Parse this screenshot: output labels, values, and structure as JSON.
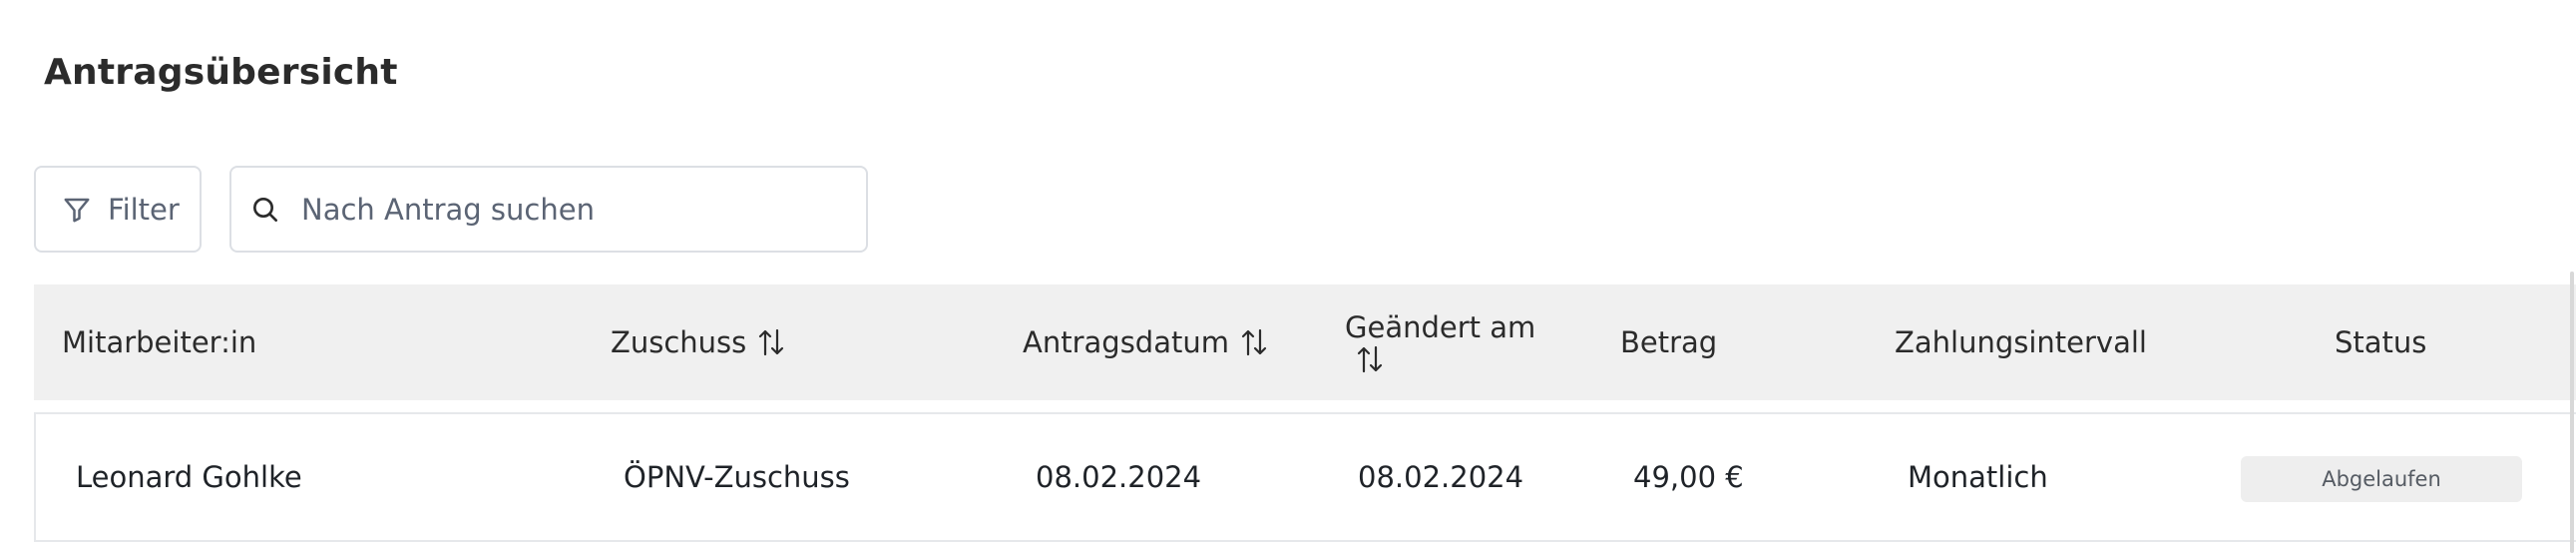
{
  "page": {
    "title": "Antragsübersicht"
  },
  "toolbar": {
    "filter_label": "Filter",
    "filter_icon": "funnel-icon",
    "search_icon": "search-icon",
    "search_placeholder": "Nach Antrag suchen",
    "search_value": ""
  },
  "table": {
    "columns": [
      {
        "label": "Mitarbeiter:in",
        "sortable": false
      },
      {
        "label": "Zuschuss",
        "sortable": true
      },
      {
        "label": "Antragsdatum",
        "sortable": true
      },
      {
        "label": "Geändert am",
        "sortable": true
      },
      {
        "label": "Betrag",
        "sortable": false
      },
      {
        "label": "Zahlungsintervall",
        "sortable": false
      },
      {
        "label": "Status",
        "sortable": false
      }
    ],
    "rows": [
      {
        "employee": "Leonard Gohlke",
        "subsidy": "ÖPNV-Zuschuss",
        "application_date": "08.02.2024",
        "changed_date": "08.02.2024",
        "amount": "49,00 €",
        "interval": "Monatlich",
        "status": "Abgelaufen"
      }
    ]
  },
  "colors": {
    "header_bg": "#f0f0f0",
    "border": "#dcdfe4",
    "status_bg": "#eeeeee",
    "muted_text": "#5b6474"
  }
}
